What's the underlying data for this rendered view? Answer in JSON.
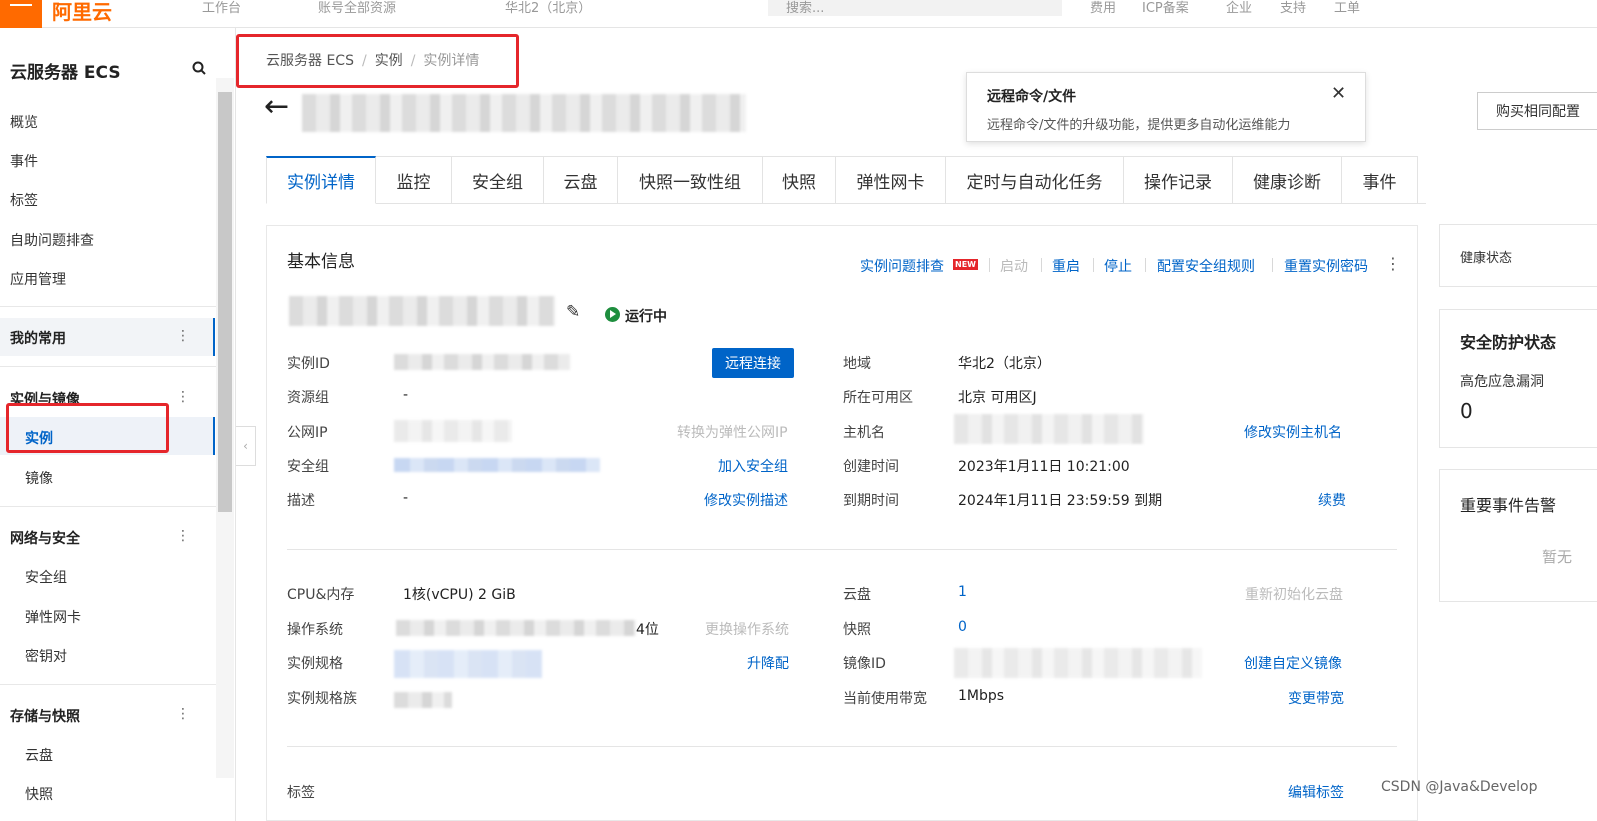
{
  "topbar": {
    "logo": "阿里云",
    "items": [
      "工作台",
      "账号全部资源",
      "华北2（北京）",
      "搜索...",
      "费用",
      "ICP备案",
      "企业",
      "支持",
      "工单"
    ]
  },
  "sidebar": {
    "title": "云服务器 ECS",
    "items": [
      "概览",
      "事件",
      "标签",
      "自助问题排查",
      "应用管理"
    ],
    "my_common": "我的常用",
    "groups": {
      "instances_images": "实例与镜像",
      "network_security": "网络与安全",
      "storage_snapshots": "存储与快照"
    },
    "sub_instances": "实例",
    "sub_images": "镜像",
    "sub_security_group": "安全组",
    "sub_eni": "弹性网卡",
    "sub_keypair": "密钥对",
    "sub_disk": "云盘",
    "sub_snapshot": "快照"
  },
  "breadcrumb": {
    "root": "云服务器 ECS",
    "mid": "实例",
    "current": "实例详情"
  },
  "tooltip": {
    "title": "远程命令/文件",
    "desc": "远程命令/文件的升级功能，提供更多自动化运维能力"
  },
  "buy_button": "购买相同配置",
  "tabs": [
    "实例详情",
    "监控",
    "安全组",
    "云盘",
    "快照一致性组",
    "快照",
    "弹性网卡",
    "定时与自动化任务",
    "操作记录",
    "健康诊断",
    "事件"
  ],
  "basic_info": {
    "title": "基本信息",
    "actions": {
      "troubleshoot": "实例问题排查",
      "new_badge": "NEW",
      "start": "启动",
      "restart": "重启",
      "stop": "停止",
      "config_sg": "配置安全组规则",
      "reset_pwd": "重置实例密码"
    },
    "status": "运行中",
    "remote_connect": "远程连接",
    "labels": {
      "instance_id": "实例ID",
      "resource_group": "资源组",
      "public_ip": "公网IP",
      "security_group": "安全组",
      "description": "描述",
      "region": "地域",
      "zone": "所在可用区",
      "hostname": "主机名",
      "created": "创建时间",
      "expire": "到期时间"
    },
    "values": {
      "resource_group": "-",
      "description": "-",
      "region": "华北2（北京）",
      "zone": "北京 可用区J",
      "created": "2023年1月11日 10:21:00",
      "expire": "2024年1月11日 23:59:59 到期"
    },
    "links": {
      "to_eip": "转换为弹性公网IP",
      "join_sg": "加入安全组",
      "edit_desc": "修改实例描述",
      "edit_hostname": "修改实例主机名",
      "renew": "续费"
    }
  },
  "config_info": {
    "labels": {
      "cpu_mem": "CPU&内存",
      "os": "操作系统",
      "spec": "实例规格",
      "spec_family": "实例规格族",
      "disk": "云盘",
      "snapshot": "快照",
      "image_id": "镜像ID",
      "bandwidth": "当前使用带宽"
    },
    "values": {
      "cpu_mem": "1核(vCPU) 2 GiB",
      "os_suffix": "4位",
      "disk": "1",
      "snapshot": "0",
      "bandwidth": "1Mbps"
    },
    "links": {
      "change_os": "更换操作系统",
      "resize": "升降配",
      "reinit_disk": "重新初始化云盘",
      "create_image": "创建自定义镜像",
      "change_bw": "变更带宽"
    }
  },
  "tags": {
    "label": "标签",
    "edit": "编辑标签"
  },
  "right_cards": {
    "health": "健康状态",
    "security_title": "安全防护状态",
    "vuln_label": "高危应急漏洞",
    "vuln_count": "0",
    "events_title": "重要事件告警",
    "events_empty": "暂无"
  },
  "watermark": "CSDN @Java&Develop"
}
